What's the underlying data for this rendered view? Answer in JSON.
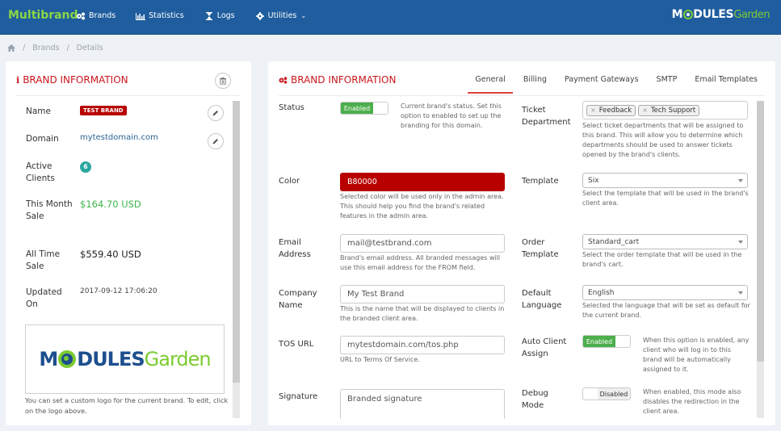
{
  "header": {
    "app_title": "Multibrand",
    "nav": [
      {
        "label": "Brands",
        "icon": "cogs-icon"
      },
      {
        "label": "Statistics",
        "icon": "bar-chart-icon"
      },
      {
        "label": "Logs",
        "icon": "hourglass-icon"
      },
      {
        "label": "Utilities",
        "icon": "gear-icon",
        "has_dropdown": true
      }
    ],
    "logo": {
      "part1": "M",
      "part2": "DULES",
      "part3": "Garden"
    }
  },
  "breadcrumb": {
    "items": [
      "Brands",
      "Details"
    ]
  },
  "left_panel": {
    "title": "BRAND INFORMATION",
    "rows": {
      "name": {
        "label": "Name",
        "value": "TEST BRAND"
      },
      "domain": {
        "label": "Domain",
        "value": "mytestdomain.com"
      },
      "active_clients": {
        "label": "Active Clients",
        "value": "6"
      },
      "this_month_sale": {
        "label": "This Month Sale",
        "value": "$164.70 USD"
      },
      "all_time_sale": {
        "label": "All Time Sale",
        "value": "$559.40 USD"
      },
      "updated_on": {
        "label": "Updated On",
        "value": "2017-09-12 17:06:20"
      }
    },
    "logo": {
      "part1": "M",
      "part2": "DULES",
      "part3": "Garden"
    },
    "logo_help": "You can set a custom logo for the current brand. To edit, click on the logo above."
  },
  "right_panel": {
    "title": "BRAND INFORMATION",
    "tabs": [
      {
        "label": "General",
        "active": true
      },
      {
        "label": "Billing",
        "active": false
      },
      {
        "label": "Payment Gateways",
        "active": false
      },
      {
        "label": "SMTP",
        "active": false
      },
      {
        "label": "Email Templates",
        "active": false
      }
    ],
    "fields": {
      "status": {
        "label": "Status",
        "value": "Enabled",
        "help": "Current brand's status. Set this option to enabled to set up the branding for this domain."
      },
      "color": {
        "label": "Color",
        "value": "B80000",
        "swatch": "#b80000",
        "help": "Selected color will be used only in the admin area. This should help you find the brand's related features in the admin area."
      },
      "email": {
        "label": "Email Address",
        "value": "mail@testbrand.com",
        "help": "Brand's email address. All branded messages will use this email address for the FROM field."
      },
      "company": {
        "label": "Company Name",
        "value": "My Test Brand",
        "help": "This is the name that will be displayed to clients in the branded client area."
      },
      "tos": {
        "label": "TOS URL",
        "value": "mytestdomain.com/tos.php",
        "help": "URL to Terms Of Service."
      },
      "signature": {
        "label": "Signature",
        "value": "Branded signature"
      },
      "ticket_department": {
        "label": "Ticket Department",
        "tags": [
          "Feedback",
          "Tech Support"
        ],
        "help": "Select ticket departments that will be assigned to this brand. This will allow you to determine which departments should be used to answer tickets opened by the brand's clients."
      },
      "template": {
        "label": "Template",
        "value": "Six",
        "help": "Select the template that will be used in the brand's client area."
      },
      "order_template": {
        "label": "Order Template",
        "value": "Standard_cart",
        "help": "Select the order template that will be used in the brand's cart."
      },
      "default_language": {
        "label": "Default Language",
        "value": "English",
        "help": "Selected the language that will be set as default for the current brand."
      },
      "auto_client_assign": {
        "label": "Auto Client Assign",
        "value": "Enabled",
        "help": "When this option is enabled, any client who will log in to this brand will be automatically assigned to it."
      },
      "debug_mode": {
        "label": "Debug Mode",
        "value": "Disabled",
        "help": "When enabled, this mode also disables the redirection in the client area."
      }
    }
  },
  "colors": {
    "header_bg": "#1f5d9e",
    "brand_green": "#8bd448",
    "title_red": "#c9161c",
    "toggle_green": "#4cae4c",
    "tab_underline": "#e0453f"
  }
}
